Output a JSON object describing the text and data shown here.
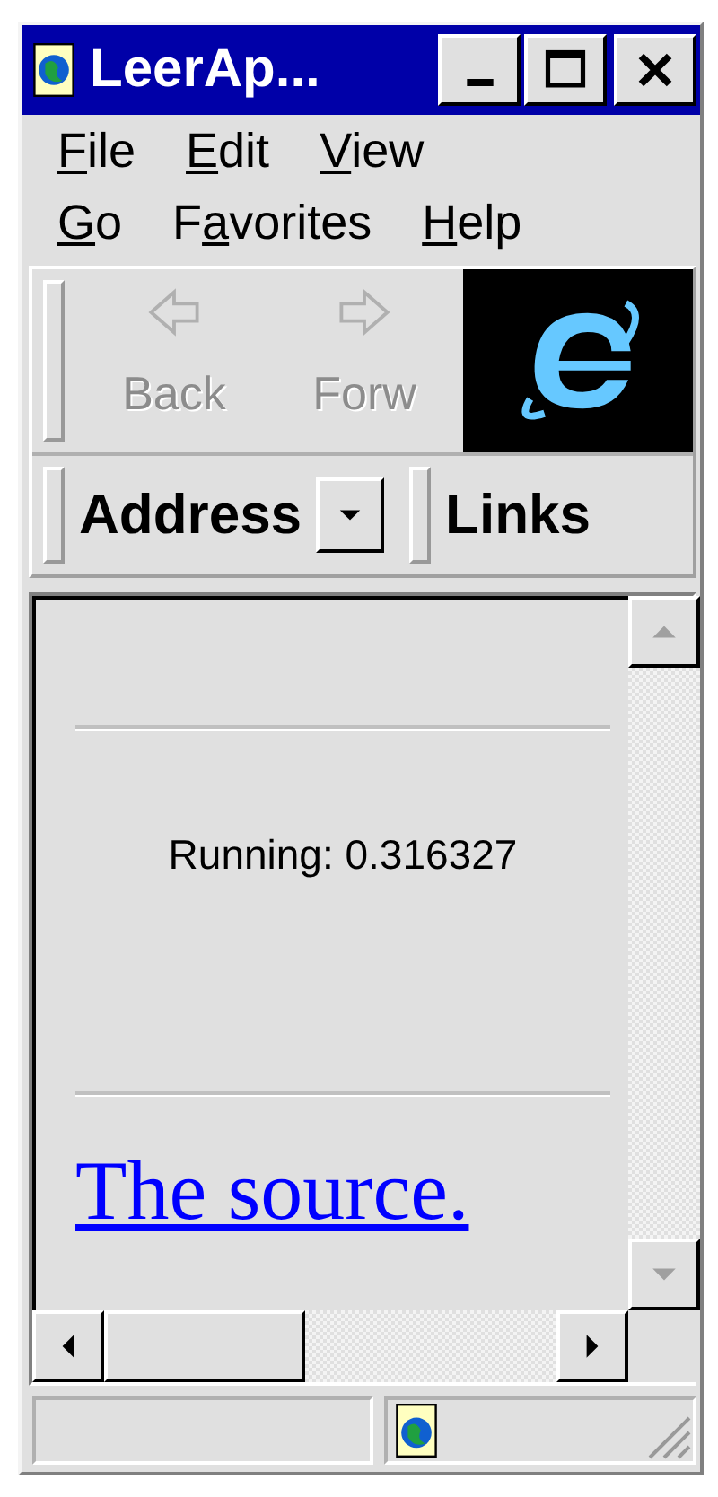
{
  "window": {
    "title": "LeerAp..."
  },
  "menu_rows": [
    [
      {
        "accel": "F",
        "after": "ile"
      },
      {
        "accel": "E",
        "after": "dit"
      },
      {
        "accel": "V",
        "after": "iew"
      }
    ],
    [
      {
        "accel": "G",
        "after": "o"
      },
      {
        "before": "F",
        "accel": "a",
        "after": "vorites"
      },
      {
        "accel": "H",
        "after": "elp"
      }
    ]
  ],
  "toolbar": {
    "buttons": [
      {
        "label": "Back",
        "kind": "back",
        "disabled": true
      },
      {
        "label": "Forw",
        "kind": "forward",
        "disabled": true
      }
    ]
  },
  "address_bar": {
    "label": "Address",
    "links_label": "Links"
  },
  "content": {
    "text": "Running: 0.316327",
    "link": "The source."
  },
  "scrollbars": {
    "up_disabled": true,
    "down_disabled": true
  }
}
